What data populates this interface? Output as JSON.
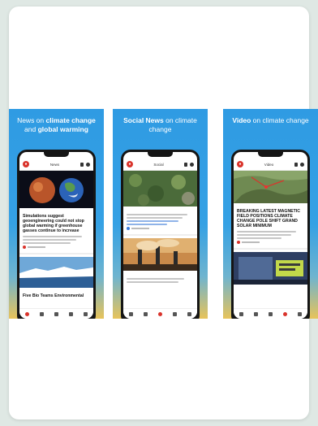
{
  "screenshots": [
    {
      "caption_prefix": "News on ",
      "caption_bold_1": "climate change",
      "caption_mid": " and ",
      "caption_bold_2": "global warming",
      "tab_title": "News",
      "headline": "Simulations suggest geoengineering could not stop global warming if greenhouse gasses continue to increase",
      "footer_headline": "Five Bio Teams Environmental"
    },
    {
      "caption_prefix": "Social News",
      "caption_rest": " on climate change",
      "tab_title": "Social"
    },
    {
      "caption_prefix": "Video",
      "caption_rest": " on climate change",
      "tab_title": "Video",
      "headline": "BREAKING LATEST MAGNETIC FIELD POSITIONS CLIMATE CHANGE POLE SHIFT GRAND SOLAR MINIMUM"
    }
  ],
  "colors": {
    "sky_blue": "#2f9be3",
    "sand_yellow": "#e7c35a",
    "brand_red": "#d9332b"
  },
  "icons": [
    "logo-icon",
    "bookmark-icon",
    "gear-icon",
    "home-tab-icon",
    "news-tab-icon",
    "social-tab-icon",
    "video-tab-icon",
    "settings-tab-icon"
  ]
}
